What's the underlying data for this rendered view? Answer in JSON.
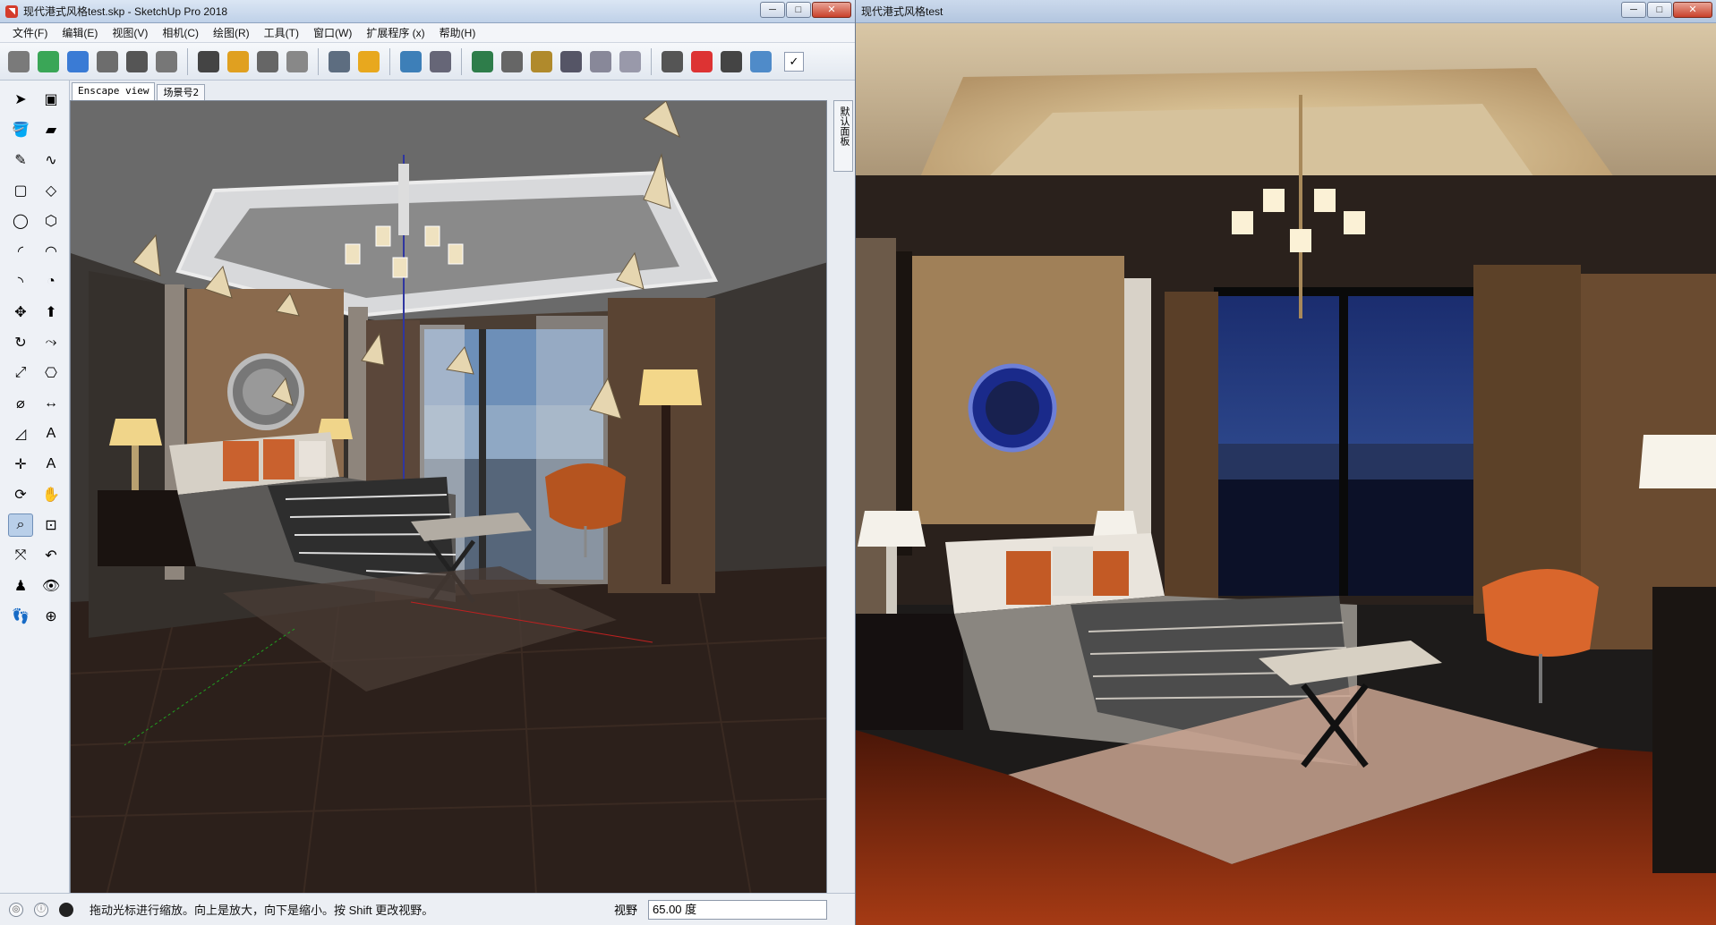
{
  "sketchup_window": {
    "title": "现代港式风格test.skp - SketchUp Pro 2018",
    "controls": {
      "minimize": "─",
      "maximize": "□",
      "close": "✕"
    },
    "menu": [
      "文件(F)",
      "编辑(E)",
      "视图(V)",
      "相机(C)",
      "绘图(R)",
      "工具(T)",
      "窗口(W)",
      "扩展程序 (x)",
      "帮助(H)"
    ],
    "toolbar": {
      "icons": [
        "footprint-icon",
        "refresh-icon",
        "enscape-sync-icon",
        "camera-path-icon",
        "screenshot-icon",
        "audio-icon",
        "vr-headset-icon",
        "shield-add-icon",
        "render-settings-icon",
        "sliders-icon",
        "feedback-icon",
        "shield-icon",
        "export-image-icon",
        "export-exe-icon",
        "upload-panorama-icon",
        "batch-export-icon",
        "folder-view-icon",
        "save-view-icon",
        "link-icon",
        "sync-views-icon",
        "house-icon",
        "cloud-upload-icon",
        "move-view-icon",
        "cube-icon"
      ],
      "check_label": "✓"
    },
    "scene_tabs": [
      "Enscape view",
      "场景号2"
    ],
    "side_panel_label": "默认面板",
    "status_text": "拖动光标进行缩放。向上是放大，向下是缩小。按 Shift 更改视野。",
    "vcb_label": "视野",
    "vcb_value": "65.00 度"
  },
  "render_window": {
    "title": "现代港式风格test",
    "controls": {
      "minimize": "─",
      "maximize": "□",
      "close": "✕"
    }
  },
  "palette_tools": [
    [
      "select-tool-icon",
      "component-tool-icon"
    ],
    [
      "paint-bucket-icon",
      "eraser-icon"
    ],
    [
      "line-tool-icon",
      "freehand-tool-icon"
    ],
    [
      "rectangle-tool-icon",
      "rotated-rectangle-icon"
    ],
    [
      "circle-tool-icon",
      "polygon-tool-icon"
    ],
    [
      "arc-tool-icon",
      "two-point-arc-icon"
    ],
    [
      "three-point-arc-icon",
      "pie-tool-icon"
    ],
    [
      "move-tool-icon",
      "push-pull-icon"
    ],
    [
      "rotate-tool-icon",
      "follow-me-icon"
    ],
    [
      "scale-tool-icon",
      "offset-tool-icon"
    ],
    [
      "tape-measure-icon",
      "dimension-icon"
    ],
    [
      "protractor-icon",
      "text-tool-icon"
    ],
    [
      "axes-tool-icon",
      "3d-text-icon"
    ],
    [
      "orbit-tool-icon",
      "pan-tool-icon"
    ],
    [
      "zoom-tool-icon",
      "zoom-window-icon"
    ],
    [
      "zoom-extents-icon",
      "previous-view-icon"
    ],
    [
      "position-camera-icon",
      "look-around-icon"
    ],
    [
      "walk-tool-icon",
      "section-plane-icon"
    ]
  ]
}
